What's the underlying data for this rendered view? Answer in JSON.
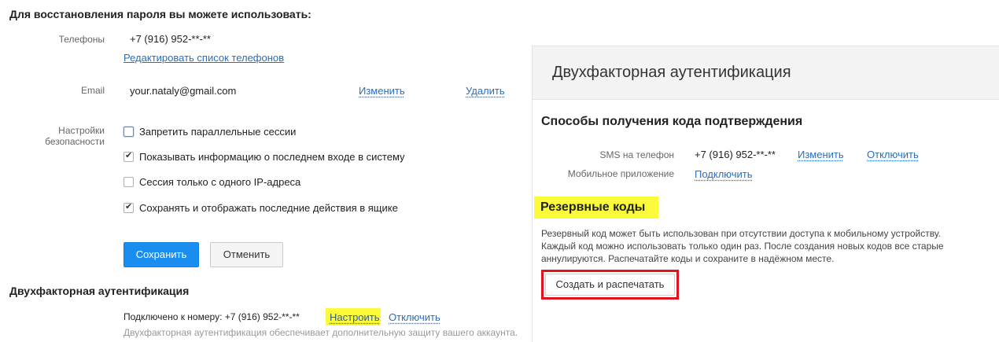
{
  "recovery": {
    "title": "Для восстановления пароля вы можете использовать:",
    "phones_label": "Телефоны",
    "phone_value": "+7 (916) 952-**-**",
    "edit_phones_link": "Редактировать список телефонов",
    "email_label": "Email",
    "email_value": "your.nataly@gmail.com",
    "email_change": "Изменить",
    "email_delete": "Удалить",
    "security_label_1": "Настройки",
    "security_label_2": "безопасности",
    "options": [
      {
        "label": "Запретить параллельные сессии",
        "checked": false
      },
      {
        "label": "Показывать информацию о последнем входе в систему",
        "checked": true
      },
      {
        "label": "Сессия только с одного IP-адреса",
        "checked": false
      },
      {
        "label": "Сохранять и отображать последние действия в ящике",
        "checked": true
      }
    ],
    "save_button": "Сохранить",
    "cancel_button": "Отменить"
  },
  "twofa": {
    "title": "Двухфакторная аутентификация",
    "connected_text": "Подключено к номеру: +7 (916) 952-**-**",
    "setup_link": "Настроить",
    "disable_link": "Отключить",
    "description": "Двухфакторная аутентификация обеспечивает дополнительную защиту вашего аккаунта."
  },
  "panel": {
    "title": "Двухфакторная аутентификация",
    "methods_title": "Способы получения кода подтверждения",
    "sms_label": "SMS на телефон",
    "sms_value": "+7 (916) 952-**-**",
    "sms_change": "Изменить",
    "sms_disable": "Отключить",
    "app_label": "Мобильное приложение",
    "app_connect": "Подключить",
    "backup_title": "Резервные коды",
    "backup_text_1": "Резервный код может быть использован при отсутствии доступа к мобильному устройству.",
    "backup_text_2": "Каждый код можно использовать только один раз. После создания новых кодов все старые",
    "backup_text_3": "аннулируются. Распечатайте коды и сохраните в надёжном месте.",
    "create_button": "Создать и распечатать"
  },
  "colors": {
    "primary": "#1a8ef0",
    "link": "#2a6ebb",
    "highlight": "#fbfb3a",
    "annotation_red": "#e0141e"
  }
}
